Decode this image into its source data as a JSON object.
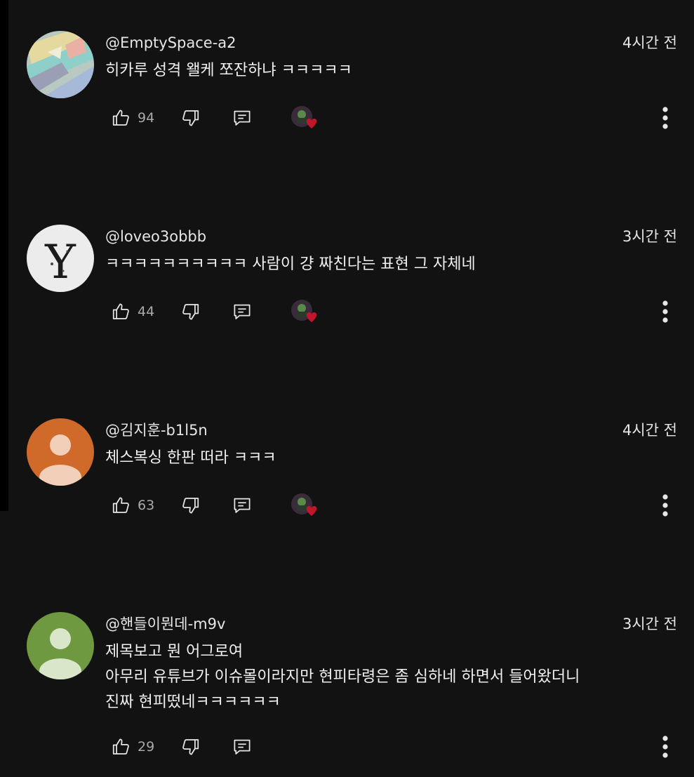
{
  "colors": {
    "background": "#121212",
    "text": "#f1f1f1",
    "muted": "#aaaaaa",
    "heart": "#c0152a"
  },
  "comments": [
    {
      "author": "@EmptySpace-a2",
      "time": "4시간 전",
      "lines": [
        "히카루 성격 왤케 쪼잔하냐 ㅋㅋㅋㅋㅋ"
      ],
      "likes": "94",
      "creator_heart": true,
      "avatar_icon": "pastel-abstract-avatar"
    },
    {
      "author": "@loveo3obbb",
      "time": "3시간 전",
      "lines": [
        "ㅋㅋㅋㅋㅋㅋㅋㅋㅋㅋ 사람이 걍 짜친다는 표현 그 자체네"
      ],
      "likes": "44",
      "creator_heart": true,
      "avatar_icon": "letter-y-avatar"
    },
    {
      "author": "@김지훈-b1l5n",
      "time": "4시간 전",
      "lines": [
        "체스복싱 한판 떠라 ㅋㅋㅋ"
      ],
      "likes": "63",
      "creator_heart": true,
      "avatar_icon": "default-person-avatar"
    },
    {
      "author": "@핸들이뭔데-m9v",
      "time": "3시간 전",
      "lines": [
        "제목보고 뭔 어그로여",
        "아무리 유튜브가 이슈몰이라지만 현피타령은 좀 심하네 하면서 들어왔더니",
        "진짜 현피떴네ㅋㅋㅋㅋㅋㅋ"
      ],
      "likes": "29",
      "creator_heart": false,
      "avatar_icon": "default-person-avatar"
    }
  ]
}
